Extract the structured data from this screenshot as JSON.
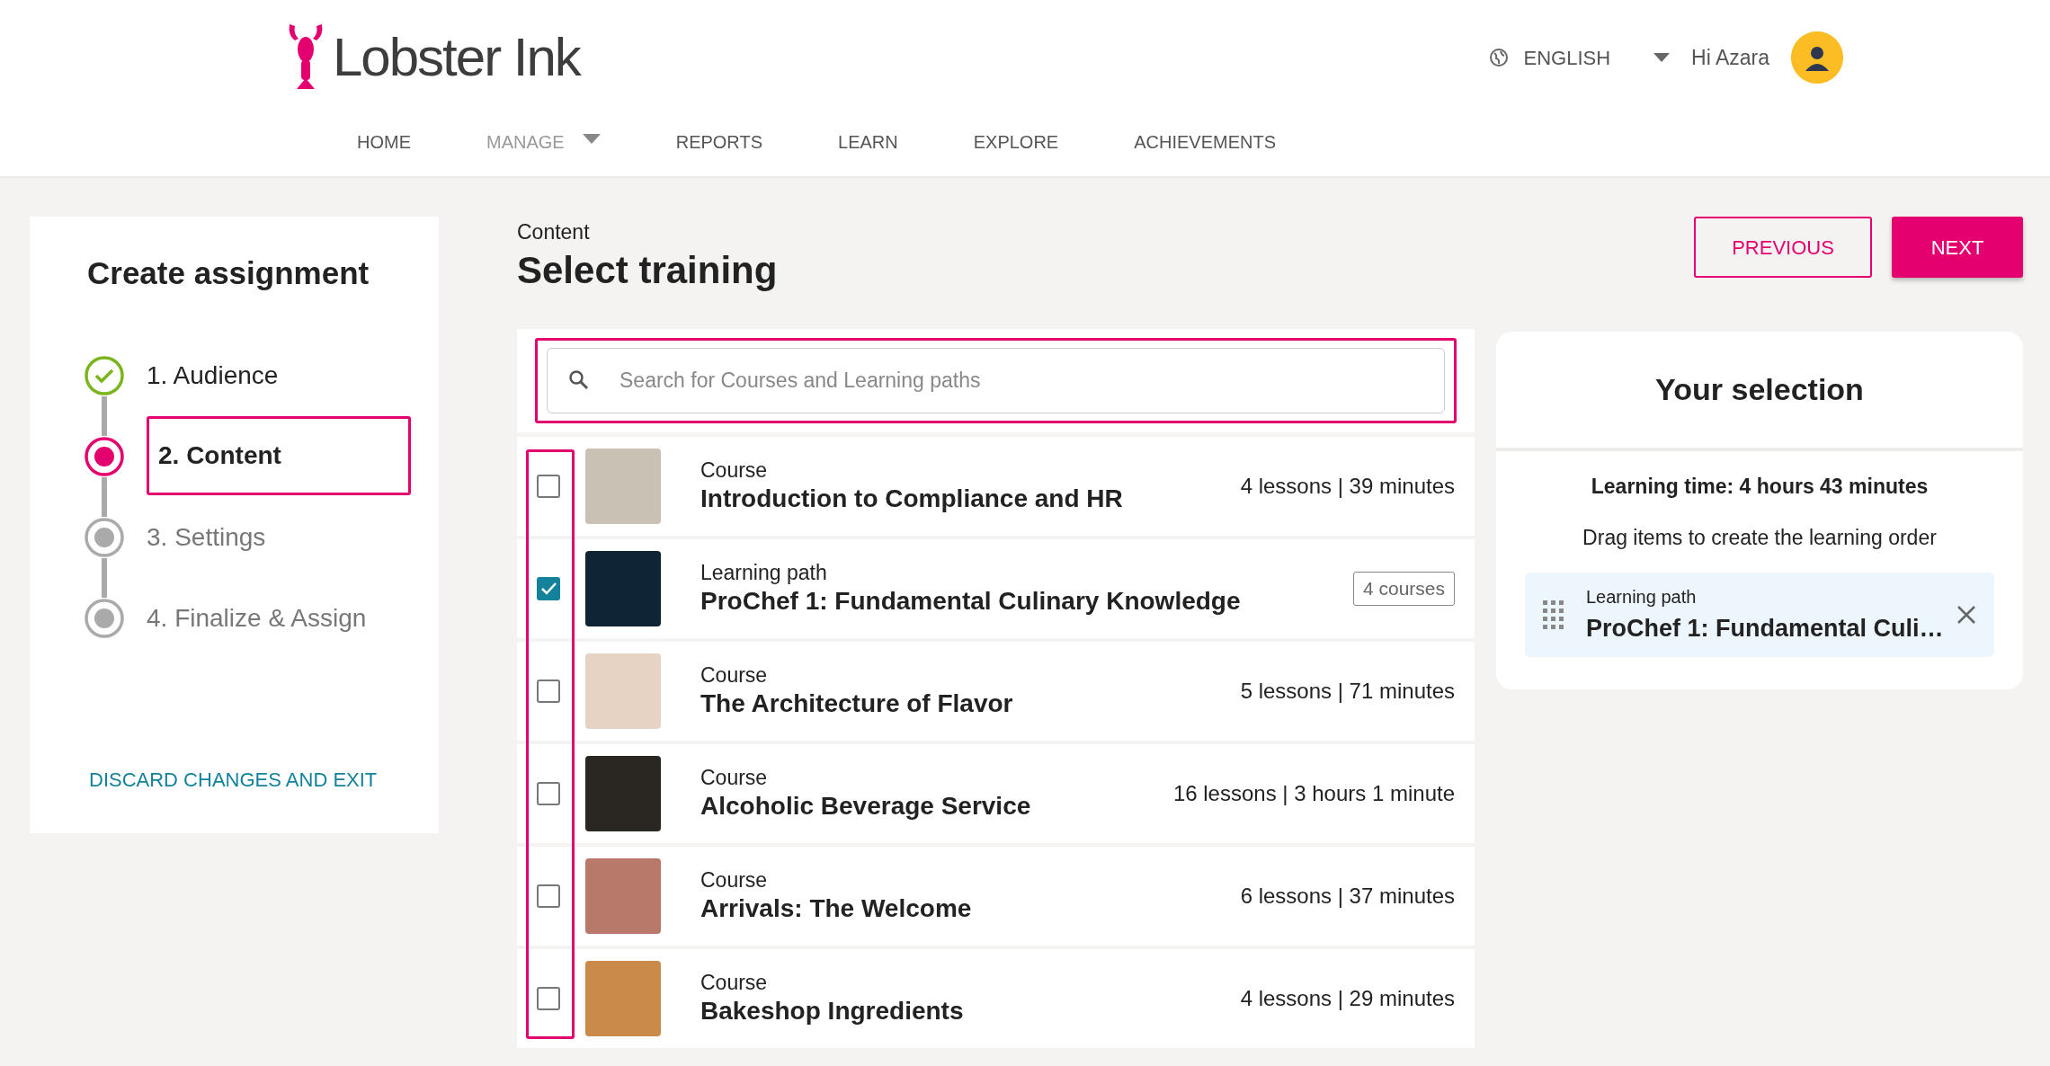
{
  "header": {
    "logo_text": "Lobster Ink",
    "language": "ENGLISH",
    "greeting": "Hi Azara"
  },
  "nav": [
    {
      "label": "HOME",
      "selected": false,
      "dropdown": false
    },
    {
      "label": "MANAGE",
      "selected": true,
      "dropdown": true
    },
    {
      "label": "REPORTS",
      "selected": false,
      "dropdown": false
    },
    {
      "label": "LEARN",
      "selected": false,
      "dropdown": false
    },
    {
      "label": "EXPLORE",
      "selected": false,
      "dropdown": false
    },
    {
      "label": "ACHIEVEMENTS",
      "selected": false,
      "dropdown": false
    }
  ],
  "sidebar": {
    "title": "Create assignment",
    "steps": [
      {
        "label": "1. Audience",
        "completed": true,
        "selected": false
      },
      {
        "label": "2. Content",
        "completed": false,
        "selected": true
      },
      {
        "label": "3. Settings",
        "completed": false,
        "selected": false
      },
      {
        "label": "4. Finalize & Assign",
        "completed": false,
        "selected": false
      }
    ],
    "discard_link": "DISCARD CHANGES AND EXIT"
  },
  "main": {
    "eyebrow": "Content",
    "title": "Select training",
    "search": {
      "placeholder": "Search for Courses and Learning paths"
    },
    "items": [
      {
        "type": "Course",
        "title": "Introduction to Compliance and HR",
        "meta": {
          "kind": "text",
          "text": "4 lessons | 39 minutes"
        },
        "checked": false
      },
      {
        "type": "Learning path",
        "title": "ProChef 1: Fundamental Culinary Knowledge",
        "meta": {
          "kind": "badge",
          "text": "4 courses"
        },
        "checked": true
      },
      {
        "type": "Course",
        "title": "The Architecture of Flavor",
        "meta": {
          "kind": "text",
          "text": "5 lessons | 71 minutes"
        },
        "checked": false
      },
      {
        "type": "Course",
        "title": "Alcoholic Beverage Service",
        "meta": {
          "kind": "text",
          "text": "16 lessons | 3 hours 1 minute"
        },
        "checked": false
      },
      {
        "type": "Course",
        "title": "Arrivals: The Welcome",
        "meta": {
          "kind": "text",
          "text": "6 lessons | 37 minutes"
        },
        "checked": false
      },
      {
        "type": "Course",
        "title": "Bakeshop Ingredients",
        "meta": {
          "kind": "text",
          "text": "4 lessons | 29 minutes"
        },
        "checked": false
      }
    ]
  },
  "buttons": {
    "previous": "PREVIOUS",
    "next": "NEXT"
  },
  "selection": {
    "title": "Your selection",
    "learning_time": "Learning time: 4 hours 43 minutes",
    "hint": "Drag items to create the learning order",
    "items": [
      {
        "type": "Learning path",
        "title": "ProChef 1: Fundamental Culi…"
      }
    ]
  }
}
